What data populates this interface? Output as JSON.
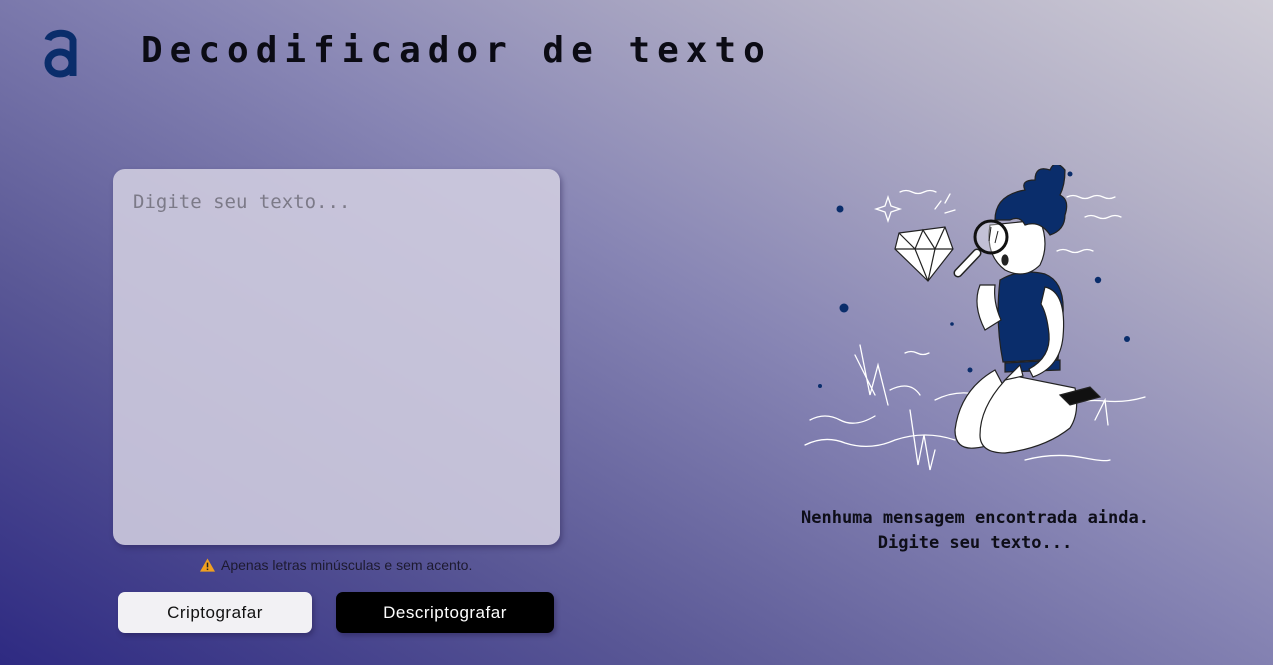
{
  "header": {
    "logo_icon": "alura-a-logo-icon",
    "title": "Decodificador de texto"
  },
  "input": {
    "placeholder": "Digite seu texto...",
    "value": ""
  },
  "warning": {
    "icon": "warning-triangle-icon",
    "text": "Apenas letras minúsculas e sem acento."
  },
  "buttons": {
    "encrypt_label": "Criptografar",
    "decrypt_label": "Descriptografar"
  },
  "output": {
    "illustration_icon": "person-with-magnifying-glass-illustration",
    "message_line1": "Nenhuma mensagem encontrada ainda.",
    "message_line2": "Digite seu texto..."
  },
  "colors": {
    "brand_navy": "#0a2d6b",
    "warning": "#f0a020",
    "decrypt_button": "#000000",
    "encrypt_button": "#f2f1f4"
  }
}
